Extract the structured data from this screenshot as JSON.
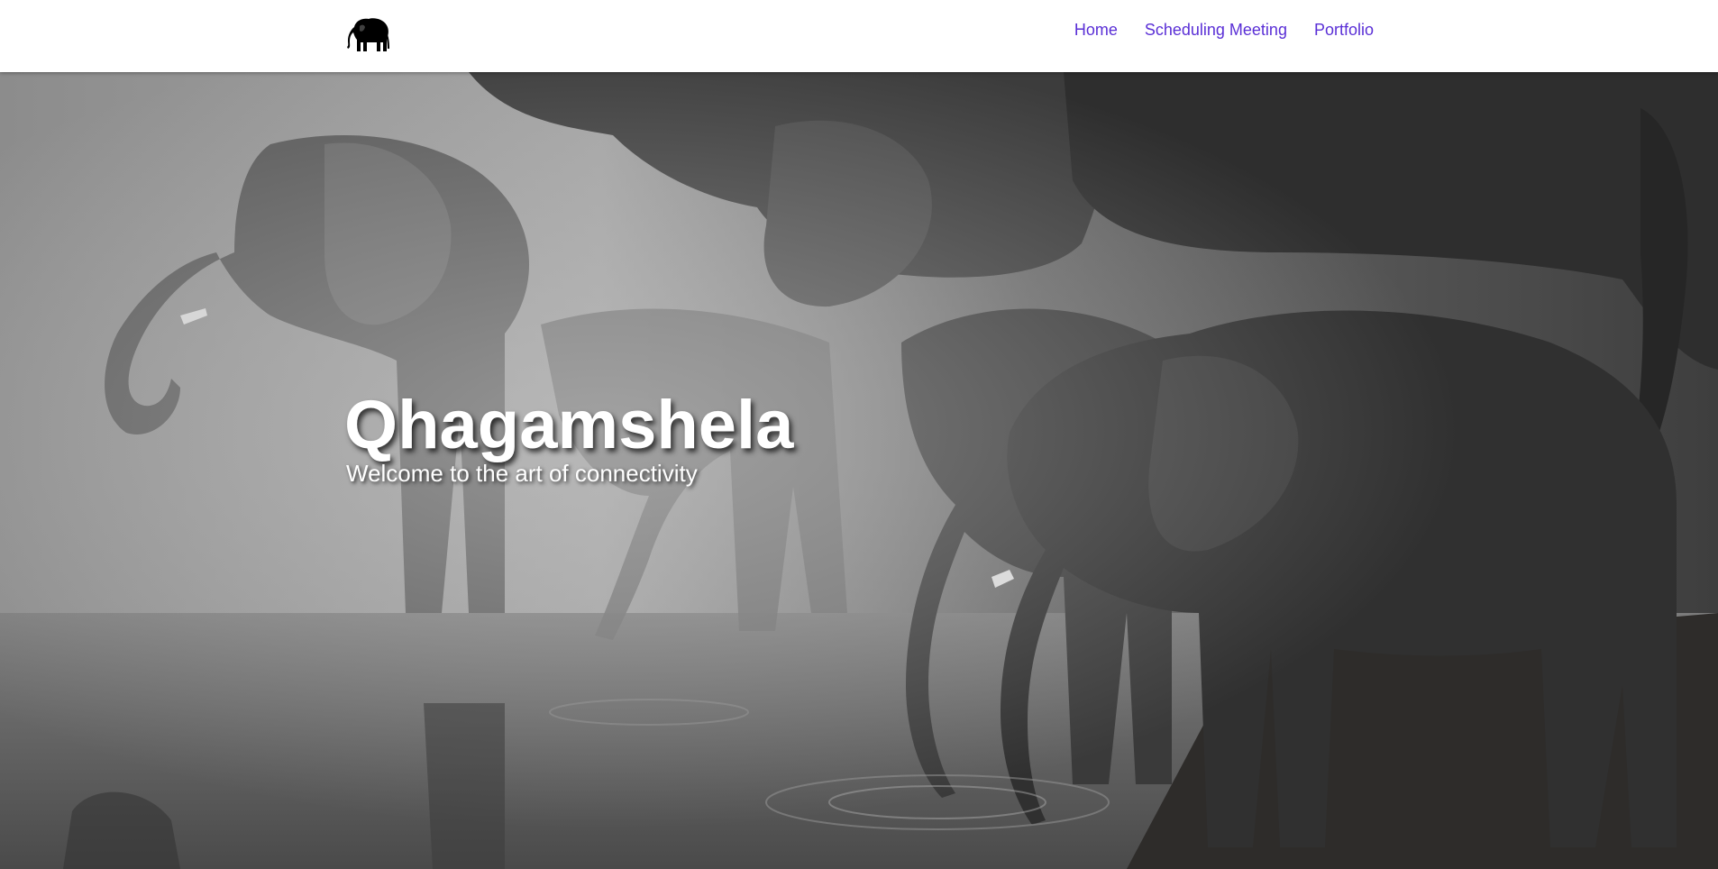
{
  "header": {
    "logo_icon": "elephant-icon",
    "nav": {
      "home": "Home",
      "scheduling": "Scheduling Meeting",
      "portfolio": "Portfolio"
    },
    "link_color": "#5a2fd6"
  },
  "hero": {
    "title": "Qhagamshela",
    "subtitle": "Welcome to the art of connectivity",
    "background_image": "herd of elephants drinking at a waterhole, black and white photograph"
  }
}
